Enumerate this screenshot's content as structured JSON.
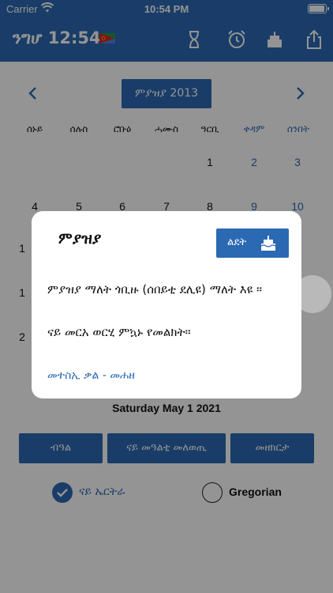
{
  "status": {
    "carrier": "Carrier",
    "time": "10:54 PM"
  },
  "nav": {
    "title": "ንግሆ 12:54"
  },
  "calendar": {
    "month_label": "ምያዝያ 2013",
    "weekdays": [
      "ሰኑይ",
      "ሰሉስ",
      "ሮቡዕ",
      "ሓሙስ",
      "ዓርቢ",
      "ቀዳም",
      "ሰንበት"
    ],
    "row1": [
      "1",
      "2",
      "3"
    ],
    "row2": [
      "4",
      "5",
      "6",
      "7",
      "8",
      "9",
      "10"
    ],
    "partial_left": [
      "1",
      "1",
      "2"
    ]
  },
  "gregorian_date": "Saturday May 1 2021",
  "buttons": {
    "b1": "ብዓል",
    "b2": "ናይ መዓልቲ መለወጢ",
    "b3": "መዘክርታ"
  },
  "options": {
    "eritrean": "ናይ ኤርትራ",
    "gregorian": "Gregorian"
  },
  "modal": {
    "title": "ምያዝያ",
    "birthday_label": "ልደት",
    "body1": "ምያዝያ ማለት ጎቢዙ (ሰበይቲ ደሊዩ) ማለት እዩ ።",
    "body2": "ናይ መርአ ወርሂ ምኳኑ የመልክት።",
    "link": "መተስኢ ቃል  -  መሐዘ"
  },
  "colors": {
    "primary": "#2b69b3",
    "flag_green": "#1f9d3f",
    "flag_red": "#e2231a",
    "flag_blue": "#4189dd",
    "flag_gold": "#f4c400"
  },
  "icons": [
    "wifi-icon",
    "battery-icon",
    "eritrea-flag-icon",
    "hourglass-icon",
    "alarm-clock-icon",
    "cake-icon",
    "share-icon",
    "chevron-left-icon",
    "chevron-right-icon",
    "checkmark-icon"
  ]
}
